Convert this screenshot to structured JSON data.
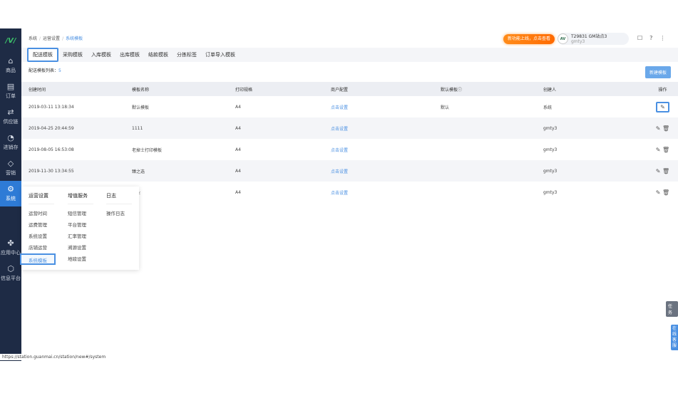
{
  "sidebar": {
    "logo": "/V/",
    "items": [
      {
        "label": "商品",
        "icon": "bag-icon",
        "glyph": "⌂"
      },
      {
        "label": "订单",
        "icon": "order-icon",
        "glyph": "▤"
      },
      {
        "label": "供应链",
        "icon": "exchange-icon",
        "glyph": "⇄"
      },
      {
        "label": "进销存",
        "icon": "inventory-icon",
        "glyph": "◔"
      },
      {
        "label": "营销",
        "icon": "tag-icon",
        "glyph": "◇"
      },
      {
        "label": "系统",
        "icon": "gear-icon",
        "glyph": "⚙"
      },
      {
        "label": "应用中心",
        "icon": "apps-icon",
        "glyph": "✤"
      },
      {
        "label": "信息平台",
        "icon": "cube-icon",
        "glyph": "⬡"
      }
    ]
  },
  "breadcrumb": [
    "系统",
    "运营设置",
    "系统模板"
  ],
  "header": {
    "promo": "新功能上线，点击查看",
    "avatar": "AV",
    "user_name": "T29831 GM站点3",
    "user_sub": "gmty3",
    "icons": [
      "☐",
      "?",
      "⋮"
    ]
  },
  "tabs": [
    "配送模板",
    "采购模板",
    "入库模板",
    "出库模板",
    "结款模板",
    "分拣标签",
    "订单导入模板"
  ],
  "count_label": "配送模板列表：",
  "count": "5",
  "new_button": "新建模板",
  "table": {
    "headers": [
      "创建时间",
      "模板名称",
      "打印规格",
      "商户配置",
      "默认模板ⓘ",
      "创建人",
      "操作"
    ],
    "rows": [
      {
        "time": "2019-03-11 13:18:34",
        "name": "默认模板",
        "size": "A4",
        "config": "点击设置",
        "default": "默认",
        "creator": "系统"
      },
      {
        "time": "2019-04-25 20:44:59",
        "name": "1111",
        "size": "A4",
        "config": "点击设置",
        "default": "",
        "creator": "gmty3"
      },
      {
        "time": "2019-08-05 16:53:08",
        "name": "老掉士打印模板",
        "size": "A4",
        "config": "点击设置",
        "default": "",
        "creator": "gmty3"
      },
      {
        "time": "2019-11-30 13:34:55",
        "name": "臻之选",
        "size": "A4",
        "config": "点击设置",
        "default": "",
        "creator": "gmty3"
      },
      {
        "time": "",
        "name": "农业",
        "size": "A4",
        "config": "点击设置",
        "default": "",
        "creator": "gmty3"
      }
    ]
  },
  "menu": {
    "cols": [
      {
        "title": "运营设置",
        "items": [
          "运营时间",
          "运费管理",
          "系统设置",
          "店铺运营",
          "系统模板"
        ]
      },
      {
        "title": "增值服务",
        "items": [
          "短信管理",
          "平台管理",
          "汇率管理",
          "溯源设置",
          "地磅设置"
        ]
      },
      {
        "title": "日志",
        "items": [
          "操作日志"
        ]
      }
    ]
  },
  "status_url": "https://station.guanmai.cn/station/new#/system",
  "float": {
    "task": "任务",
    "service": "在线客服"
  }
}
